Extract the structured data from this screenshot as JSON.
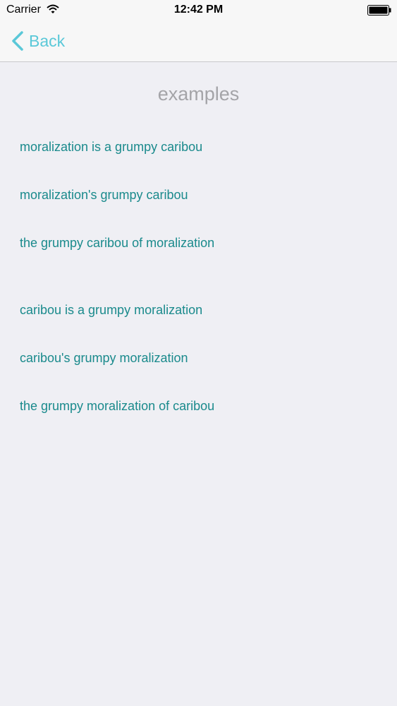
{
  "status_bar": {
    "carrier": "Carrier",
    "time": "12:42 PM",
    "icons": [
      "wifi-icon",
      "battery-icon"
    ]
  },
  "nav": {
    "back_label": "Back",
    "back_icon": "chevron-left-icon",
    "accent_color": "#5ac8d8"
  },
  "section_title": "examples",
  "examples": [
    "moralization is a grumpy caribou",
    "moralization's grumpy caribou",
    "the grumpy caribou of moralization",
    "caribou is a grumpy moralization",
    "caribou's grumpy moralization",
    "the grumpy moralization of caribou"
  ],
  "colors": {
    "link_text": "#1a8a8c",
    "title_text": "#a4a4a8",
    "background": "#efeff4"
  }
}
